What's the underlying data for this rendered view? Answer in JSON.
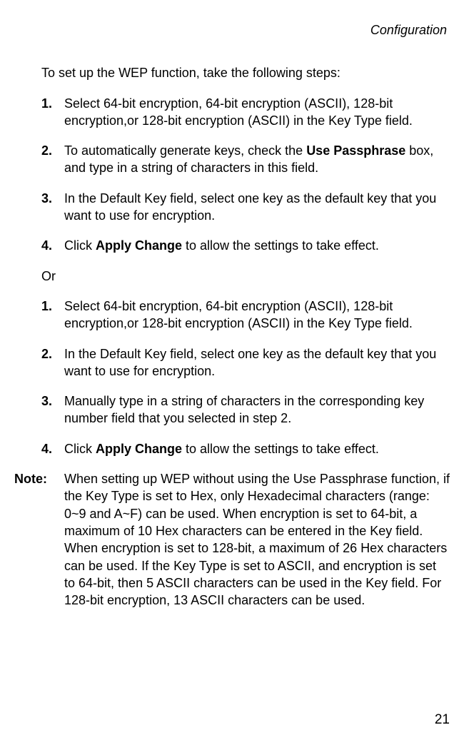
{
  "header": "Configuration",
  "intro": "To set up the WEP function, take the following steps:",
  "list1": {
    "items": [
      {
        "num": "1.",
        "pre": "Select 64-bit encryption, 64-bit encryption (ASCII), 128-bit encryption,or 128-bit encryption (ASCII) in the Key Type field.",
        "bold": "",
        "post": ""
      },
      {
        "num": "2.",
        "pre": "To automatically generate keys, check the ",
        "bold": "Use Passphrase",
        "post": " box, and type in a string of characters in this field."
      },
      {
        "num": "3.",
        "pre": "In the Default Key field, select one key as the default key that you want to use for encryption.",
        "bold": "",
        "post": ""
      },
      {
        "num": "4.",
        "pre": "Click ",
        "bold": "Apply Change",
        "post": " to allow the settings to take effect."
      }
    ]
  },
  "or": "Or",
  "list2": {
    "items": [
      {
        "num": "1.",
        "pre": "Select 64-bit encryption, 64-bit encryption (ASCII), 128-bit encryption,or 128-bit encryption (ASCII) in the Key Type field.",
        "bold": "",
        "post": ""
      },
      {
        "num": "2.",
        "pre": "In the Default Key field, select one key as the default key that you want to use for encryption.",
        "bold": "",
        "post": ""
      },
      {
        "num": "3.",
        "pre": "Manually type in a string of characters in the corresponding key number field that you selected in step 2.",
        "bold": "",
        "post": ""
      },
      {
        "num": "4.",
        "pre": "Click ",
        "bold": "Apply Change",
        "post": " to allow the settings to take effect."
      }
    ]
  },
  "note": {
    "label": "Note:",
    "text": "When setting up WEP without using the Use Passphrase function, if the Key Type is set to Hex, only Hexadecimal characters (range: 0~9 and A~F) can be used. When encryption is set to 64-bit, a maximum of 10 Hex characters can be entered in the Key field. When encryption is set to 128-bit, a maximum of 26 Hex characters can be used. If the Key Type is set to ASCII, and encryption is set to 64-bit, then 5 ASCII characters can be used in the Key field. For 128-bit encryption, 13 ASCII characters can be used."
  },
  "pageNum": "21"
}
